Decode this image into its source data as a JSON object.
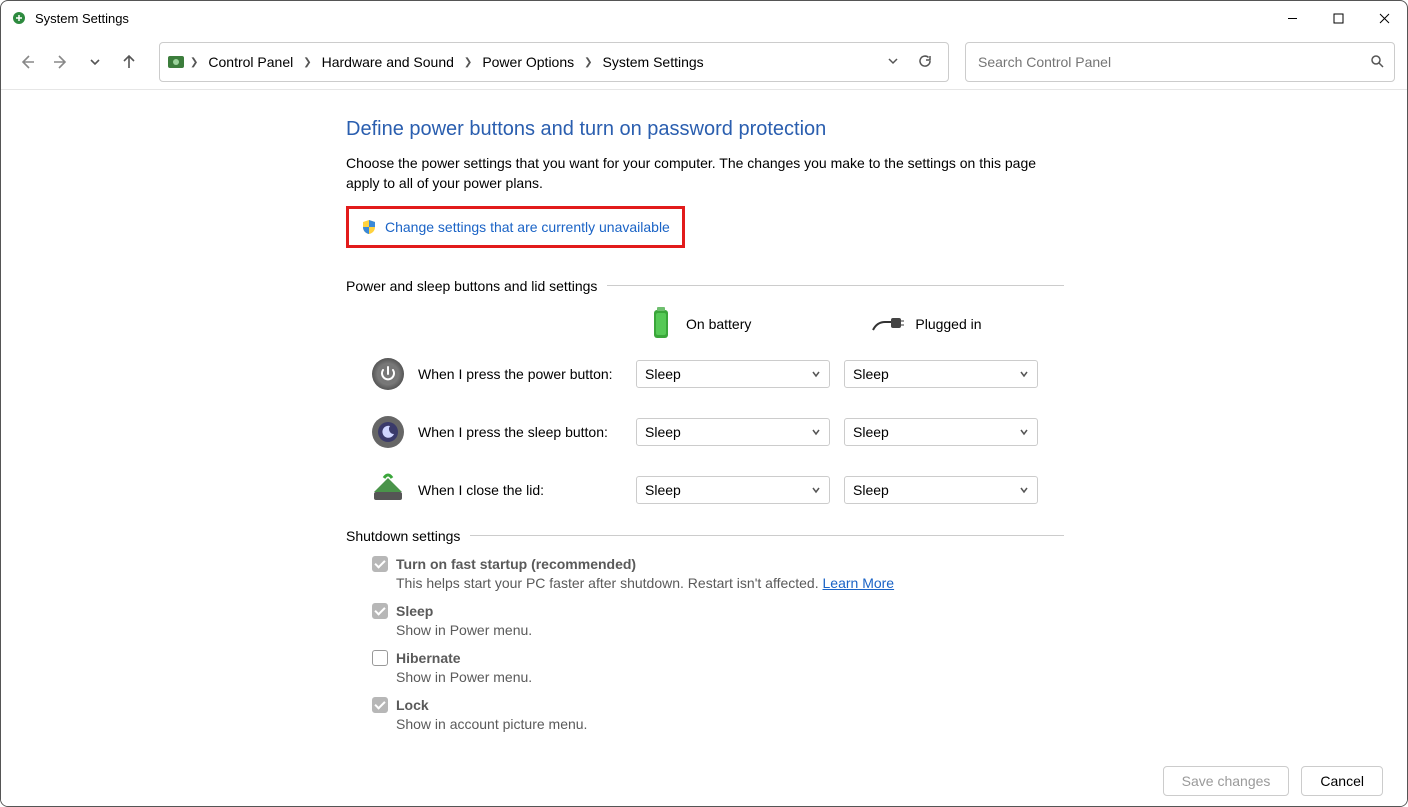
{
  "window": {
    "title": "System Settings"
  },
  "breadcrumb": {
    "items": [
      "Control Panel",
      "Hardware and Sound",
      "Power Options",
      "System Settings"
    ]
  },
  "search": {
    "placeholder": "Search Control Panel"
  },
  "page": {
    "heading": "Define power buttons and turn on password protection",
    "description": "Choose the power settings that you want for your computer. The changes you make to the settings on this page apply to all of your power plans.",
    "change_link": "Change settings that are currently unavailable"
  },
  "group1": {
    "title": "Power and sleep buttons and lid settings",
    "col_battery": "On battery",
    "col_plugged": "Plugged in",
    "rows": [
      {
        "label": "When I press the power button:",
        "battery": "Sleep",
        "plugged": "Sleep"
      },
      {
        "label": "When I press the sleep button:",
        "battery": "Sleep",
        "plugged": "Sleep"
      },
      {
        "label": "When I close the lid:",
        "battery": "Sleep",
        "plugged": "Sleep"
      }
    ]
  },
  "group2": {
    "title": "Shutdown settings",
    "items": [
      {
        "title": "Turn on fast startup (recommended)",
        "sub_pre": "This helps start your PC faster after shutdown. Restart isn't affected. ",
        "learn": "Learn More",
        "checked": true
      },
      {
        "title": "Sleep",
        "sub_pre": "Show in Power menu.",
        "learn": "",
        "checked": true
      },
      {
        "title": "Hibernate",
        "sub_pre": "Show in Power menu.",
        "learn": "",
        "checked": false
      },
      {
        "title": "Lock",
        "sub_pre": "Show in account picture menu.",
        "learn": "",
        "checked": true
      }
    ]
  },
  "footer": {
    "save": "Save changes",
    "cancel": "Cancel"
  }
}
